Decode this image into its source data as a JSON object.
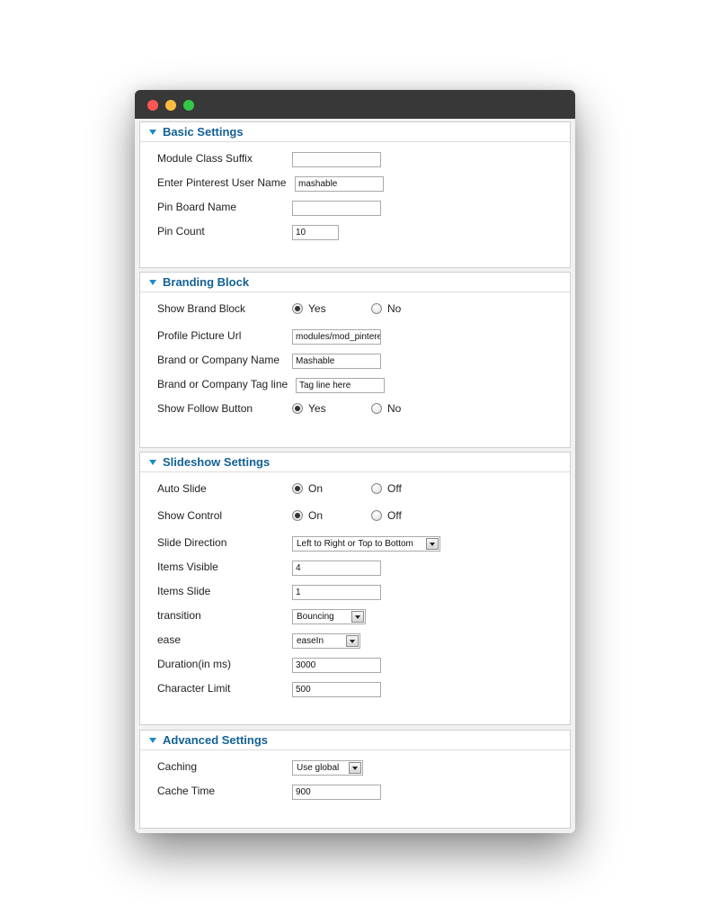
{
  "basic": {
    "title": "Basic Settings",
    "module_class_suffix": {
      "label": "Module Class Suffix",
      "value": ""
    },
    "pinterest_user": {
      "label": "Enter Pinterest User Name",
      "value": "mashable"
    },
    "pin_board": {
      "label": "Pin Board Name",
      "value": ""
    },
    "pin_count": {
      "label": "Pin Count",
      "value": "10"
    }
  },
  "branding": {
    "title": "Branding Block",
    "show_brand_block": {
      "label": "Show Brand Block",
      "option_yes": "Yes",
      "option_no": "No",
      "selected": "Yes"
    },
    "profile_picture_url": {
      "label": "Profile Picture Url",
      "value": "modules/mod_pinterest"
    },
    "company_name": {
      "label": "Brand or Company Name",
      "value": "Mashable"
    },
    "tag_line": {
      "label": "Brand or Company Tag line",
      "value": "Tag line here"
    },
    "show_follow_button": {
      "label": "Show Follow Button",
      "option_yes": "Yes",
      "option_no": "No",
      "selected": "Yes"
    }
  },
  "slideshow": {
    "title": "Slideshow Settings",
    "auto_slide": {
      "label": "Auto Slide",
      "option_on": "On",
      "option_off": "Off",
      "selected": "On"
    },
    "show_control": {
      "label": "Show Control",
      "option_on": "On",
      "option_off": "Off",
      "selected": "On"
    },
    "slide_direction": {
      "label": "Slide Direction",
      "value": "Left to Right or Top to Bottom"
    },
    "items_visible": {
      "label": "Items Visible",
      "value": "4"
    },
    "items_slide": {
      "label": "Items Slide",
      "value": "1"
    },
    "transition": {
      "label": "transition",
      "value": "Bouncing"
    },
    "ease": {
      "label": "ease",
      "value": "easeIn"
    },
    "duration": {
      "label": "Duration(in ms)",
      "value": "3000"
    },
    "character_limit": {
      "label": "Character Limit",
      "value": "500"
    }
  },
  "advanced": {
    "title": "Advanced Settings",
    "caching": {
      "label": "Caching",
      "value": "Use global"
    },
    "cache_time": {
      "label": "Cache Time",
      "value": "900"
    }
  }
}
